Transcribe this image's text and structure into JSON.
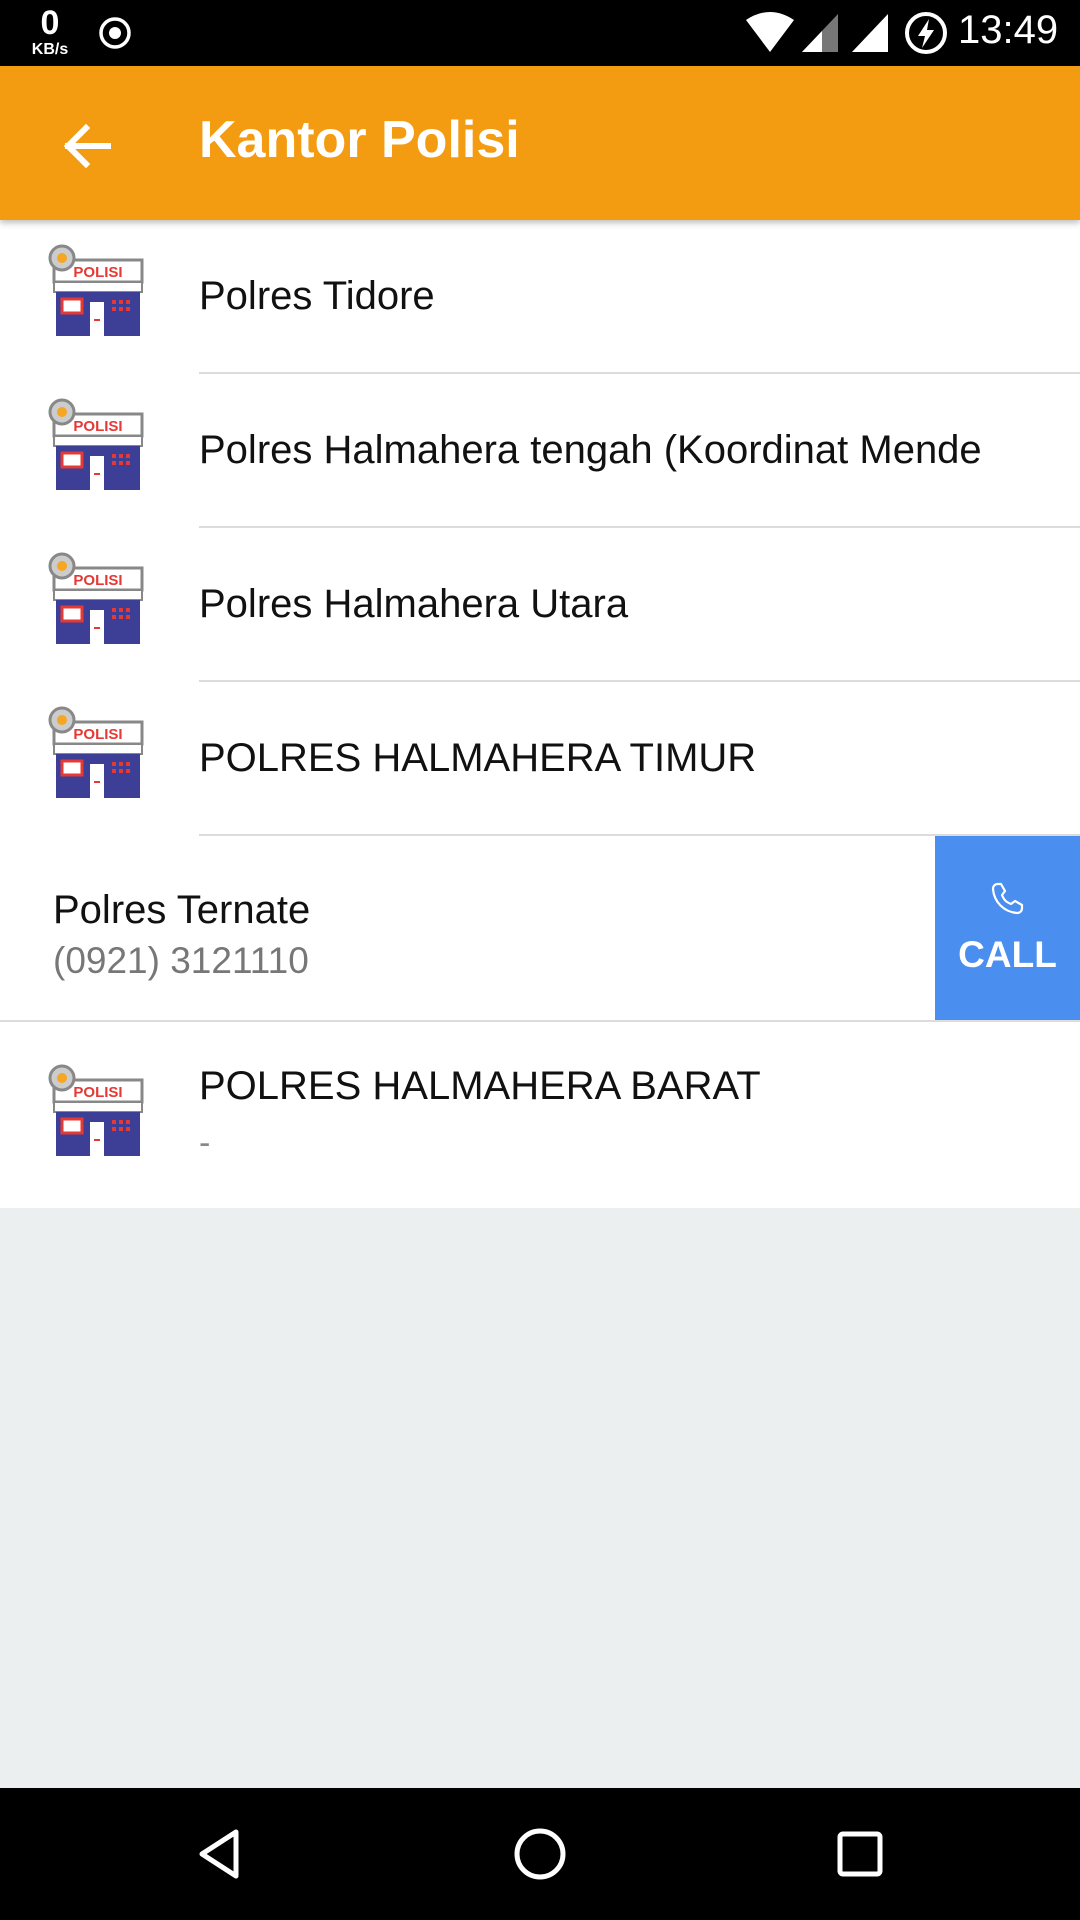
{
  "status_bar": {
    "speed_value": "0",
    "speed_unit": "KB/s",
    "time": "13:49",
    "icons": [
      "sync-icon",
      "wifi-icon",
      "signal-icon",
      "signal-icon",
      "battery-charging-icon"
    ]
  },
  "toolbar": {
    "title": "Kantor Polisi",
    "back_icon": "arrow-left-icon",
    "color": "#f39c12"
  },
  "list": {
    "items": [
      {
        "name": "Polres Tidore",
        "icon": "police-station-icon",
        "badge": "POLISI"
      },
      {
        "name": "Polres Halmahera tengah (Koordinat Mende",
        "icon": "police-station-icon",
        "badge": "POLISI"
      },
      {
        "name": "Polres Halmahera Utara",
        "icon": "police-station-icon",
        "badge": "POLISI"
      },
      {
        "name": "POLRES HALMAHERA TIMUR",
        "icon": "police-station-icon",
        "badge": "POLISI"
      }
    ],
    "swiped_item": {
      "name": "Polres Ternate",
      "phone": "(0921) 3121110",
      "action_label": "CALL",
      "action_color": "#4a8ff0"
    },
    "last_item": {
      "name": "POLRES HALMAHERA BARAT",
      "subtitle": "-",
      "badge": "POLISI"
    }
  },
  "nav_bar": {
    "icons": [
      "back-triangle-icon",
      "home-circle-icon",
      "recents-square-icon"
    ]
  }
}
